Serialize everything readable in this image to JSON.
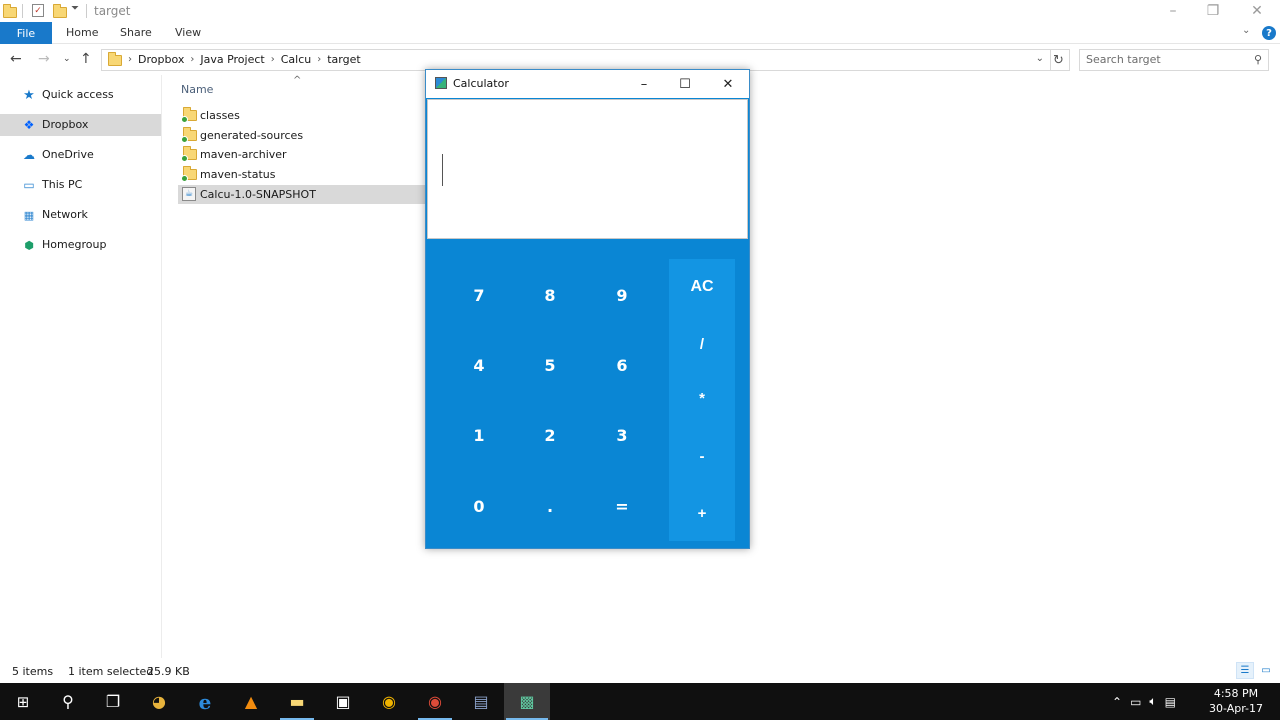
{
  "explorer": {
    "window_title": "target",
    "ribbon": {
      "file": "File",
      "home": "Home",
      "share": "Share",
      "view": "View"
    },
    "address": {
      "crumbs": [
        "Dropbox",
        "Java Project",
        "Calcu",
        "target"
      ]
    },
    "search": {
      "placeholder": "Search target"
    },
    "nav": [
      {
        "label": "Quick access",
        "icon": "star-icon"
      },
      {
        "label": "Dropbox",
        "icon": "dropbox-icon"
      },
      {
        "label": "OneDrive",
        "icon": "cloud-icon"
      },
      {
        "label": "This PC",
        "icon": "computer-icon"
      },
      {
        "label": "Network",
        "icon": "network-icon"
      },
      {
        "label": "Homegroup",
        "icon": "homegroup-icon"
      }
    ],
    "list": {
      "column_name": "Name",
      "items": [
        {
          "name": "classes",
          "type": "folder"
        },
        {
          "name": "generated-sources",
          "type": "folder"
        },
        {
          "name": "maven-archiver",
          "type": "folder"
        },
        {
          "name": "maven-status",
          "type": "folder"
        },
        {
          "name": "Calcu-1.0-SNAPSHOT",
          "type": "jar"
        }
      ]
    },
    "status": {
      "items": "5 items",
      "selected": "1 item selected",
      "size": "25.9 KB"
    }
  },
  "calculator": {
    "title": "Calculator",
    "display_value": "",
    "digits": [
      "7",
      "8",
      "9",
      "4",
      "5",
      "6",
      "1",
      "2",
      "3",
      "0",
      ".",
      "="
    ],
    "operators": [
      "AC",
      "/",
      "*",
      "-",
      "+"
    ],
    "colors": {
      "keypad": "#0a86d4",
      "operator_column": "#1395e3"
    }
  },
  "taskbar": {
    "clock_time": "4:58 PM",
    "clock_date": "30-Apr-17"
  }
}
